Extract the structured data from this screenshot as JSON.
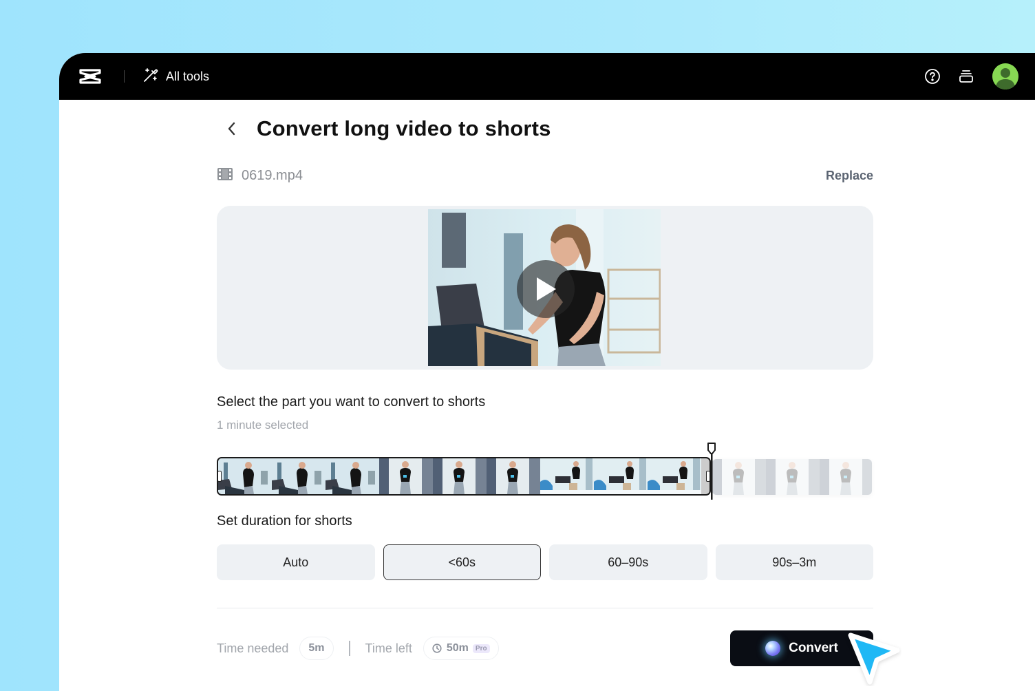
{
  "topbar": {
    "logo_icon": "capcut-logo-icon",
    "all_tools_label": "All tools",
    "all_tools_icon": "magic-wand-icon",
    "help_icon": "help-circle-icon",
    "stack_icon": "layers-stack-icon",
    "avatar_icon": "user-avatar-icon",
    "avatar_color": "#87d853"
  },
  "page": {
    "title": "Convert long video to shorts",
    "back_icon": "chevron-left-icon"
  },
  "file": {
    "icon": "film-icon",
    "name": "0619.mp4",
    "replace_label": "Replace"
  },
  "preview": {
    "play_icon": "play-icon"
  },
  "selection": {
    "label": "Select the part you want to convert to shorts",
    "selected_text": "1 minute selected",
    "selected_fraction": 0.75
  },
  "duration": {
    "label": "Set duration for shorts",
    "options": [
      {
        "label": "Auto",
        "active": false
      },
      {
        "label": "<60s",
        "active": true
      },
      {
        "label": "60–90s",
        "active": false
      },
      {
        "label": "90s–3m",
        "active": false
      }
    ]
  },
  "footer": {
    "time_needed_label": "Time needed",
    "time_needed_value": "5m",
    "time_left_label": "Time left",
    "time_left_value": "50m",
    "clock_icon": "clock-icon",
    "pro_badge": "Pro",
    "convert_label": "Convert",
    "convert_icon": "ai-orb-icon"
  },
  "colors": {
    "background": "#a6e7fc",
    "topbar": "#000000",
    "convert_button": "#0a0d14",
    "cursor": "#1fb8f5",
    "accent_avatar": "#87d853"
  }
}
